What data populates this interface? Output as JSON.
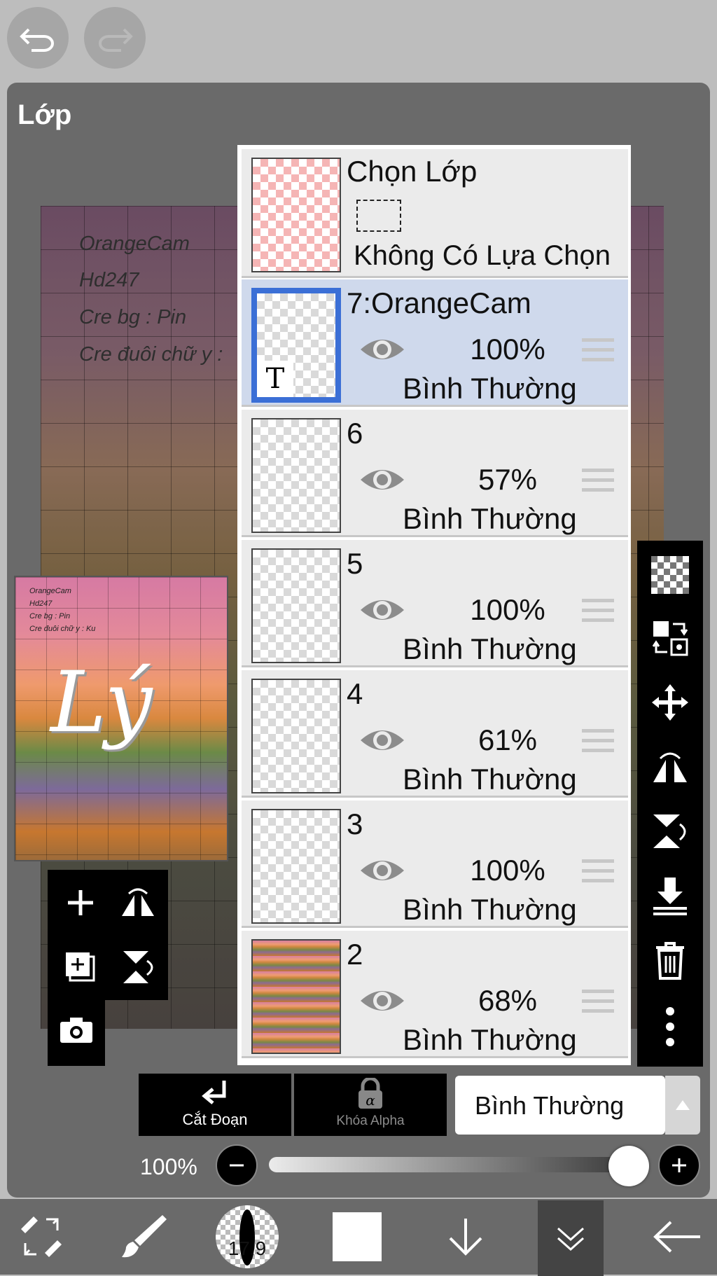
{
  "topbar": {
    "undo_icon": "undo-icon",
    "redo_icon": "redo-icon"
  },
  "panel": {
    "title": "Lớp"
  },
  "canvas": {
    "lines": [
      "OrangeCam",
      "Hd247",
      "Cre bg : Pin",
      "Cre đuôi chữ y :"
    ]
  },
  "preview": {
    "lines": [
      "OrangeCam",
      "Hd247",
      "Cre bg : Pin",
      "Cre đuôi chữ y : Ku"
    ],
    "script": "Lý"
  },
  "selection": {
    "title": "Chọn Lớp",
    "status": "Không Có Lựa Chọn"
  },
  "layers": [
    {
      "name": "7:OrangeCam",
      "opacity": "100%",
      "mode": "Bình Thường",
      "selected": true,
      "thumb": "T"
    },
    {
      "name": "6",
      "opacity": "57%",
      "mode": "Bình Thường",
      "selected": false
    },
    {
      "name": "5",
      "opacity": "100%",
      "mode": "Bình Thường",
      "selected": false
    },
    {
      "name": "4",
      "opacity": "61%",
      "mode": "Bình Thường",
      "selected": false
    },
    {
      "name": "3",
      "opacity": "100%",
      "mode": "Bình Thường",
      "selected": false
    },
    {
      "name": "2",
      "opacity": "68%",
      "mode": "Bình Thường",
      "selected": false
    }
  ],
  "controls": {
    "clip_label": "Cắt Đoạn",
    "alpha_label": "Khóa Alpha",
    "blend_mode": "Bình Thường",
    "opacity_label": "100%",
    "opacity_value": 1.0
  },
  "bottombar": {
    "brush_size": "17.9"
  }
}
